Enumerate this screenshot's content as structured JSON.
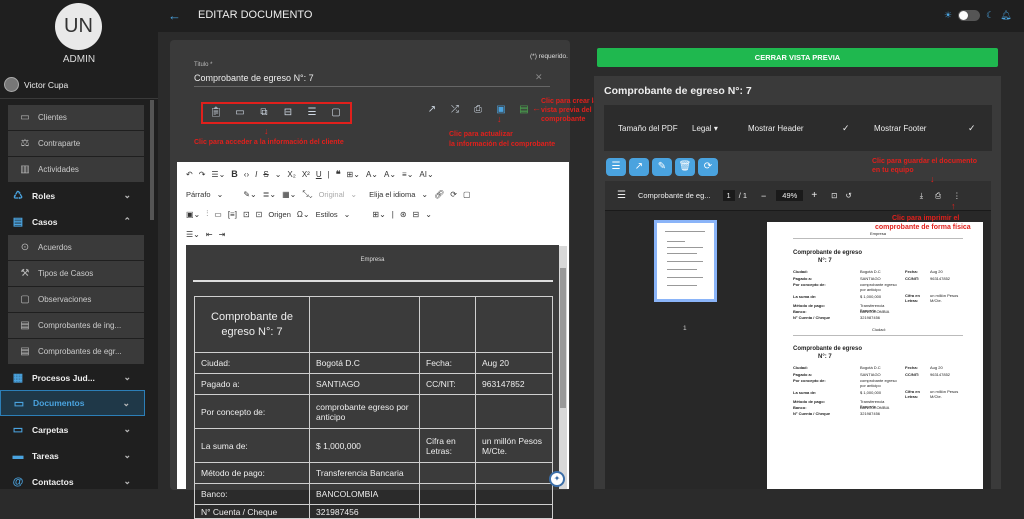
{
  "sidebar": {
    "avatar_initials": "UN",
    "role": "ADMIN",
    "user_name": "Victor Cupa",
    "items": [
      {
        "label": "Clientes",
        "icon": "clipboard-icon",
        "type": "sub"
      },
      {
        "label": "Contraparte",
        "icon": "balance-icon",
        "type": "sub"
      },
      {
        "label": "Actividades",
        "icon": "bar-chart-icon",
        "type": "sub"
      },
      {
        "label": "Roles",
        "icon": "roles-icon",
        "type": "main",
        "chevron": "⌄"
      },
      {
        "label": "Casos",
        "icon": "briefcase-icon",
        "type": "main",
        "chevron": "⌃"
      },
      {
        "label": "Acuerdos",
        "icon": "handshake-icon",
        "type": "sub"
      },
      {
        "label": "Tipos de Casos",
        "icon": "wrench-icon",
        "type": "sub"
      },
      {
        "label": "Observaciones",
        "icon": "comment-icon",
        "type": "sub"
      },
      {
        "label": "Comprobantes de ing...",
        "icon": "receipt-icon",
        "type": "sub"
      },
      {
        "label": "Comprobantes de egr...",
        "icon": "receipt-icon",
        "type": "sub"
      },
      {
        "label": "Procesos Jud...",
        "icon": "building-icon",
        "type": "main",
        "chevron": "⌄"
      },
      {
        "label": "Documentos",
        "icon": "folder-icon",
        "type": "main",
        "chevron": "⌄",
        "active": true
      },
      {
        "label": "Carpetas",
        "icon": "folder-open-icon",
        "type": "main",
        "chevron": "⌄"
      },
      {
        "label": "Tareas",
        "icon": "tasks-icon",
        "type": "main",
        "chevron": "⌄"
      },
      {
        "label": "Contactos",
        "icon": "at-icon",
        "type": "main",
        "chevron": "⌄"
      }
    ]
  },
  "header": {
    "title": "EDITAR DOCUMENTO"
  },
  "form": {
    "required_note": "(*) requerido.",
    "title_label": "Titulo *",
    "title_value": "Comprobante de egreso N°: 7"
  },
  "annotations": {
    "client_info": "Clic para acceder a la información del cliente",
    "update_info_1": "Clic para actualizar",
    "update_info_2": "la información del comprobante",
    "preview_1": "Clic para crear la",
    "preview_2": "vista previa del",
    "preview_3": "comprobante",
    "save_1": "Clic para guardar el documento",
    "save_2": "en tu equipo",
    "print_1": "Clic para imprimir el",
    "print_2": "comprobante de forma física"
  },
  "editor": {
    "paragraph": "Párrafo",
    "original": "Original",
    "language": "Elija el idioma",
    "source": "Origen",
    "styles": "Estilos",
    "company": "Empresa",
    "receipt_title": "Comprobante de egreso N°: 7",
    "rows": [
      [
        "Ciudad:",
        "Bogotá D.C",
        "Fecha:",
        "Aug 20"
      ],
      [
        "Pagado a:",
        "SANTIAGO",
        "CC/NIT:",
        "963147852"
      ],
      [
        "Por concepto de:",
        "comprobante egreso por anticipo",
        "",
        ""
      ],
      [
        "La suma de:",
        "$ 1,000,000",
        "Cifra en Letras:",
        "un millón Pesos M/Cte."
      ],
      [
        "Método de pago:",
        "Transferencia Bancaria",
        "",
        ""
      ],
      [
        "Banco:",
        "BANCOLOMBIA",
        "",
        ""
      ],
      [
        "N° Cuenta / Cheque",
        "321987456",
        "",
        ""
      ]
    ]
  },
  "preview": {
    "close_label": "CERRAR VISTA PREVIA",
    "title": "Comprobante de egreso N°: 7",
    "pdf_size_label": "Tamaño del PDF",
    "pdf_size_value": "Legal",
    "show_header": "Mostrar Header",
    "show_footer": "Mostrar Footer",
    "viewer_title": "Comprobante de eg...",
    "page_current": "1",
    "page_total": "/ 1",
    "zoom": "49%",
    "thumb_number": "1",
    "pdf": {
      "header": "Empresa",
      "footer": "Ciudad:",
      "title_1": "Comprobante de egreso",
      "title_2": "N°: 7",
      "labels": [
        "Ciudad:",
        "Pagado a:",
        "Por concepto de:",
        "La suma de:",
        "Método de pago:",
        "Banco:",
        "N° Cuenta / Cheque"
      ],
      "values": [
        "Bogotá D.C",
        "SANTIAGO",
        "comprobante egreso por anticipo",
        "$ 1,000,000",
        "Transferencia Bancaria",
        "BANCOLOMBIA",
        "321987456"
      ],
      "right_labels": [
        "Fecha:",
        "CC/NIT:",
        "Cifra en Letras:"
      ],
      "right_values": [
        "Aug 20",
        "963147852",
        "un millón Pesos M/Cte."
      ]
    }
  }
}
